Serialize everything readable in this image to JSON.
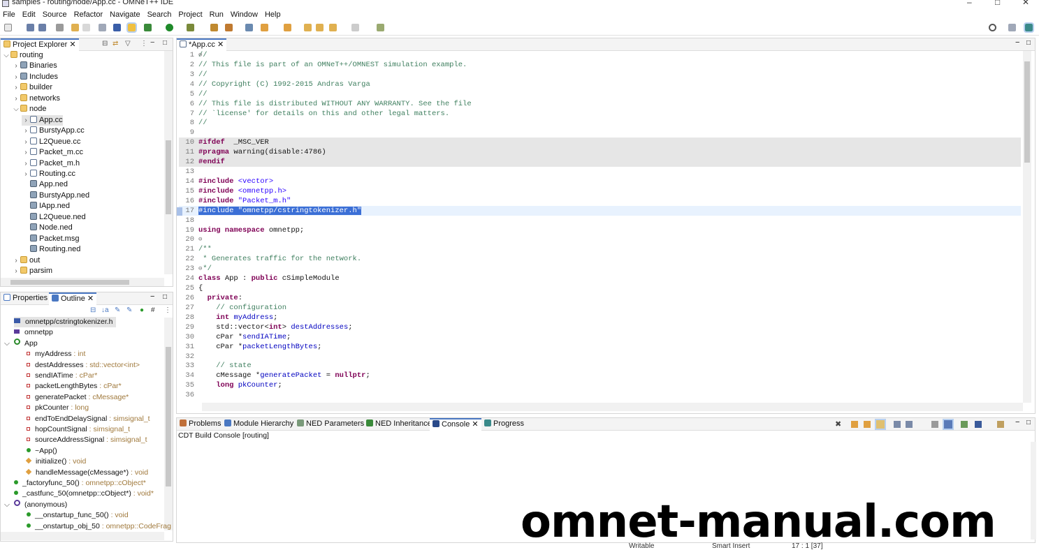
{
  "window": {
    "title": "samples - routing/node/App.cc - OMNeT++ IDE",
    "controls": [
      "–",
      "□",
      "✕"
    ]
  },
  "menubar": [
    "File",
    "Edit",
    "Source",
    "Refactor",
    "Navigate",
    "Search",
    "Project",
    "Run",
    "Window",
    "Help"
  ],
  "project_explorer": {
    "tab_label": "Project Explorer",
    "items": [
      {
        "label": "routing",
        "arrow": "⌵",
        "level": 0,
        "icon": "project-icon"
      },
      {
        "label": "Binaries",
        "arrow": "›",
        "level": 1,
        "icon": "binaries-icon"
      },
      {
        "label": "Includes",
        "arrow": "›",
        "level": 1,
        "icon": "includes-icon"
      },
      {
        "label": "builder",
        "arrow": "›",
        "level": 1,
        "icon": "folder-icon"
      },
      {
        "label": "networks",
        "arrow": "›",
        "level": 1,
        "icon": "folder-icon"
      },
      {
        "label": "node",
        "arrow": "⌵",
        "level": 1,
        "icon": "folder-icon"
      },
      {
        "label": "App.cc",
        "arrow": "›",
        "level": 2,
        "icon": "c-file-icon",
        "selected": true
      },
      {
        "label": "BurstyApp.cc",
        "arrow": "›",
        "level": 2,
        "icon": "c-file-icon"
      },
      {
        "label": "L2Queue.cc",
        "arrow": "›",
        "level": 2,
        "icon": "c-file-icon"
      },
      {
        "label": "Packet_m.cc",
        "arrow": "›",
        "level": 2,
        "icon": "c-file-icon"
      },
      {
        "label": "Packet_m.h",
        "arrow": "›",
        "level": 2,
        "icon": "h-file-icon"
      },
      {
        "label": "Routing.cc",
        "arrow": "›",
        "level": 2,
        "icon": "c-file-icon"
      },
      {
        "label": "App.ned",
        "arrow": "",
        "level": 2,
        "icon": "ned-file-icon"
      },
      {
        "label": "BurstyApp.ned",
        "arrow": "",
        "level": 2,
        "icon": "ned-file-icon"
      },
      {
        "label": "IApp.ned",
        "arrow": "",
        "level": 2,
        "icon": "ned-file-icon"
      },
      {
        "label": "L2Queue.ned",
        "arrow": "",
        "level": 2,
        "icon": "ned-file-icon"
      },
      {
        "label": "Node.ned",
        "arrow": "",
        "level": 2,
        "icon": "ned-file-icon"
      },
      {
        "label": "Packet.msg",
        "arrow": "",
        "level": 2,
        "icon": "msg-file-icon"
      },
      {
        "label": "Routing.ned",
        "arrow": "",
        "level": 2,
        "icon": "ned-file-icon"
      },
      {
        "label": "out",
        "arrow": "›",
        "level": 1,
        "icon": "folder-icon"
      },
      {
        "label": "parsim",
        "arrow": "›",
        "level": 1,
        "icon": "folder-icon"
      }
    ]
  },
  "outline": {
    "tabs": [
      "Properties",
      "Outline"
    ],
    "items": [
      {
        "label": "omnetpp/cstringtokenizer.h",
        "type": "",
        "kind": "include",
        "level": 0,
        "selected": true
      },
      {
        "label": "omnetpp",
        "type": "",
        "kind": "namespace",
        "level": 0
      },
      {
        "label": "App",
        "type": "",
        "kind": "class",
        "level": 0,
        "arrow": "⌵"
      },
      {
        "label": "myAddress",
        "type": " : int",
        "kind": "private-field",
        "level": 1
      },
      {
        "label": "destAddresses",
        "type": " : std::vector<int>",
        "kind": "private-field",
        "level": 1
      },
      {
        "label": "sendIATime",
        "type": " : cPar*",
        "kind": "private-field",
        "level": 1
      },
      {
        "label": "packetLengthBytes",
        "type": " : cPar*",
        "kind": "private-field",
        "level": 1
      },
      {
        "label": "generatePacket",
        "type": " : cMessage*",
        "kind": "private-field",
        "level": 1
      },
      {
        "label": "pkCounter",
        "type": " : long",
        "kind": "private-field",
        "level": 1
      },
      {
        "label": "endToEndDelaySignal",
        "type": " : simsignal_t",
        "kind": "private-field",
        "level": 1
      },
      {
        "label": "hopCountSignal",
        "type": " : simsignal_t",
        "kind": "private-field",
        "level": 1
      },
      {
        "label": "sourceAddressSignal",
        "type": " : simsignal_t",
        "kind": "private-field",
        "level": 1
      },
      {
        "label": "~App()",
        "type": "",
        "kind": "public-method",
        "level": 1
      },
      {
        "label": "initialize()",
        "type": " : void",
        "kind": "protected-method",
        "level": 1
      },
      {
        "label": "handleMessage(cMessage*)",
        "type": " : void",
        "kind": "protected-method",
        "level": 1
      },
      {
        "label": "_factoryfunc_50()",
        "type": " : omnetpp::cObject*",
        "kind": "static-function",
        "level": 0
      },
      {
        "label": "_castfunc_50(omnetpp::cObject*)",
        "type": " : void*",
        "kind": "static-function",
        "level": 0
      },
      {
        "label": "(anonymous)",
        "type": "",
        "kind": "namespace-anon",
        "level": 0,
        "arrow": "⌵"
      },
      {
        "label": "__onstartup_func_50()",
        "type": " : void",
        "kind": "public-method",
        "level": 1
      },
      {
        "label": "__onstartup_obj_50",
        "type": " : omnetpp::CodeFrag",
        "kind": "static-function",
        "level": 1
      }
    ]
  },
  "editor": {
    "tab_label": "*App.cc",
    "lines": [
      {
        "n": "1",
        "fold": "⊖",
        "parts": [
          [
            "cmt",
            "//"
          ]
        ]
      },
      {
        "n": "2",
        "parts": [
          [
            "cmt",
            "// This file is part of an OMNeT++/OMNEST simulation example."
          ]
        ]
      },
      {
        "n": "3",
        "parts": [
          [
            "cmt",
            "//"
          ]
        ]
      },
      {
        "n": "4",
        "parts": [
          [
            "cmt",
            "// Copyright (C) 1992-2015 Andras Varga"
          ]
        ]
      },
      {
        "n": "5",
        "parts": [
          [
            "cmt",
            "//"
          ]
        ]
      },
      {
        "n": "6",
        "parts": [
          [
            "cmt",
            "// This file is distributed WITHOUT ANY WARRANTY. See the file"
          ]
        ]
      },
      {
        "n": "7",
        "parts": [
          [
            "cmt",
            "// `license' for details on this and other legal matters."
          ]
        ]
      },
      {
        "n": "8",
        "parts": [
          [
            "cmt",
            "//"
          ]
        ]
      },
      {
        "n": "9",
        "parts": []
      },
      {
        "n": "10",
        "bg": "grey",
        "parts": [
          [
            "pre",
            "#ifdef"
          ],
          [
            "",
            "  _MSC_VER"
          ]
        ]
      },
      {
        "n": "11",
        "bg": "grey",
        "parts": [
          [
            "pre",
            "#pragma"
          ],
          [
            "",
            " warning(disable:4786)"
          ]
        ]
      },
      {
        "n": "12",
        "bg": "grey",
        "parts": [
          [
            "pre",
            "#endif"
          ]
        ]
      },
      {
        "n": "13",
        "parts": []
      },
      {
        "n": "14",
        "parts": [
          [
            "pre",
            "#include"
          ],
          [
            "",
            " "
          ],
          [
            "str",
            "<vector>"
          ]
        ]
      },
      {
        "n": "15",
        "parts": [
          [
            "pre",
            "#include"
          ],
          [
            "",
            " "
          ],
          [
            "str",
            "<omnetpp.h>"
          ]
        ]
      },
      {
        "n": "16",
        "parts": [
          [
            "pre",
            "#include"
          ],
          [
            "",
            " "
          ],
          [
            "str",
            "\"Packet_m.h\""
          ]
        ]
      },
      {
        "n": "17",
        "bg": "cur",
        "parts": [
          [
            "sel",
            "#include \"omnetpp/cstringtokenizer.h\""
          ]
        ]
      },
      {
        "n": "18",
        "parts": []
      },
      {
        "n": "19",
        "parts": [
          [
            "kw",
            "using namespace"
          ],
          [
            "",
            " omnetpp;"
          ]
        ]
      },
      {
        "n": "20",
        "fold": "⊖",
        "parts": []
      },
      {
        "n": "21",
        "parts": [
          [
            "cmt",
            "/**"
          ]
        ]
      },
      {
        "n": "22",
        "parts": [
          [
            "cmt",
            " * Generates traffic for the network."
          ]
        ]
      },
      {
        "n": "23",
        "fold": "⊖",
        "parts": [
          [
            "cmt",
            " */"
          ]
        ]
      },
      {
        "n": "24",
        "parts": [
          [
            "kw",
            "class"
          ],
          [
            "",
            " App : "
          ],
          [
            "kw",
            "public"
          ],
          [
            "",
            " cSimpleModule"
          ]
        ]
      },
      {
        "n": "25",
        "parts": [
          [
            "",
            "{"
          ]
        ]
      },
      {
        "n": "26",
        "parts": [
          [
            "",
            "  "
          ],
          [
            "kw",
            "private"
          ],
          [
            "",
            ":"
          ]
        ]
      },
      {
        "n": "27",
        "parts": [
          [
            "",
            "    "
          ],
          [
            "cmt",
            "// configuration"
          ]
        ]
      },
      {
        "n": "28",
        "parts": [
          [
            "",
            "    "
          ],
          [
            "kw",
            "int"
          ],
          [
            "",
            " "
          ],
          [
            "fld",
            "myAddress"
          ],
          [
            "",
            ";"
          ]
        ]
      },
      {
        "n": "29",
        "parts": [
          [
            "",
            "    std::vector<"
          ],
          [
            "kw",
            "int"
          ],
          [
            "",
            "> "
          ],
          [
            "fld",
            "destAddresses"
          ],
          [
            "",
            ";"
          ]
        ]
      },
      {
        "n": "30",
        "parts": [
          [
            "",
            "    cPar *"
          ],
          [
            "fld",
            "sendIATime"
          ],
          [
            "",
            ";"
          ]
        ]
      },
      {
        "n": "31",
        "parts": [
          [
            "",
            "    cPar *"
          ],
          [
            "fld",
            "packetLengthBytes"
          ],
          [
            "",
            ";"
          ]
        ]
      },
      {
        "n": "32",
        "parts": []
      },
      {
        "n": "33",
        "parts": [
          [
            "",
            "    "
          ],
          [
            "cmt",
            "// state"
          ]
        ]
      },
      {
        "n": "34",
        "parts": [
          [
            "",
            "    cMessage *"
          ],
          [
            "fld",
            "generatePacket"
          ],
          [
            "",
            " = "
          ],
          [
            "kw",
            "nullptr"
          ],
          [
            "",
            ";"
          ]
        ]
      },
      {
        "n": "35",
        "parts": [
          [
            "",
            "    "
          ],
          [
            "kw",
            "long"
          ],
          [
            "",
            " "
          ],
          [
            "fld",
            "pkCounter"
          ],
          [
            "",
            ";"
          ]
        ]
      },
      {
        "n": "36",
        "parts": []
      }
    ]
  },
  "bottom_panel": {
    "tabs": [
      "Problems",
      "Module Hierarchy",
      "NED Parameters",
      "NED Inheritance",
      "Console",
      "Progress"
    ],
    "console_title": "CDT Build Console [routing]"
  },
  "watermark": "omnet-manual.com",
  "statusbar": {
    "writable": "Writable",
    "insert_mode": "Smart Insert",
    "position": "17 : 1 [37]"
  },
  "colors": {
    "accent": "#4a78c2",
    "selection": "#3b6fd6",
    "comment": "#3f7f5f",
    "keyword": "#7f0055",
    "string": "#2a00ff",
    "field": "#0000c0"
  }
}
